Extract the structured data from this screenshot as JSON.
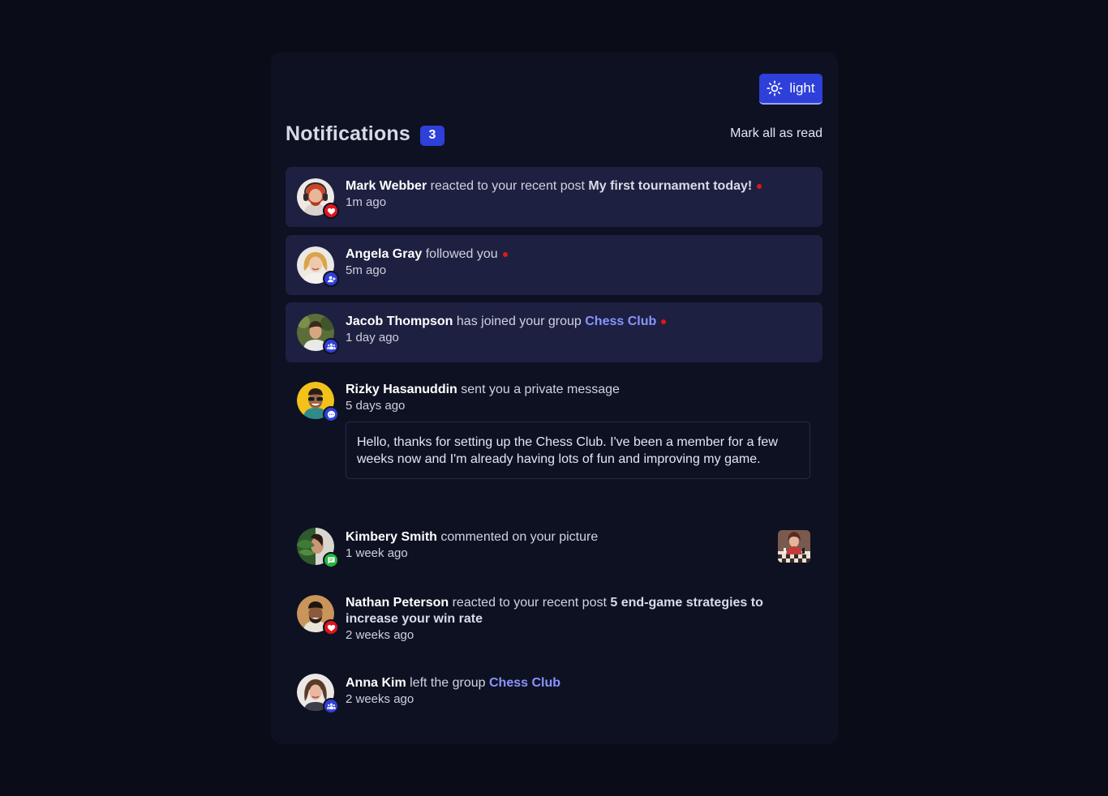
{
  "theme_toggle": {
    "label": "light",
    "icon": "sun-icon"
  },
  "header": {
    "title": "Notifications",
    "unread_count": "3",
    "mark_all_label": "Mark all as read"
  },
  "colors": {
    "background": "#0a0c18",
    "card": "#0e1122",
    "unread_row": "#1d2040",
    "accent": "#2f3fd9",
    "group_link": "#8a94ff",
    "unread_dot": "#e0161d"
  },
  "notifications": [
    {
      "name": "Mark Webber",
      "action": "reacted to your recent post",
      "post": "My first tournament today!",
      "time": "1m ago",
      "unread": true,
      "badge": "heart-icon"
    },
    {
      "name": "Angela Gray",
      "action": "followed you",
      "time": "5m ago",
      "unread": true,
      "badge": "user-add-icon"
    },
    {
      "name": "Jacob Thompson",
      "action": "has joined your group",
      "group": "Chess Club",
      "time": "1 day ago",
      "unread": true,
      "badge": "group-icon"
    },
    {
      "name": "Rizky Hasanuddin",
      "action": "sent you a private message",
      "time": "5 days ago",
      "unread": false,
      "badge": "message-icon",
      "message": "Hello, thanks for setting up the Chess Club. I've been a member for a few weeks now and I'm already having lots of fun and improving my game."
    },
    {
      "name": "Kimbery Smith",
      "action": "commented on your picture",
      "time": "1 week ago",
      "unread": false,
      "badge": "comment-icon",
      "thumbnail": "chess-picture-thumbnail"
    },
    {
      "name": "Nathan Peterson",
      "action": "reacted to your recent post",
      "post": "5 end-game strategies to increase your win rate",
      "time": "2 weeks ago",
      "unread": false,
      "badge": "heart-icon"
    },
    {
      "name": "Anna Kim",
      "action": "left the group",
      "group": "Chess Club",
      "time": "2 weeks ago",
      "unread": false,
      "badge": "group-icon"
    }
  ]
}
